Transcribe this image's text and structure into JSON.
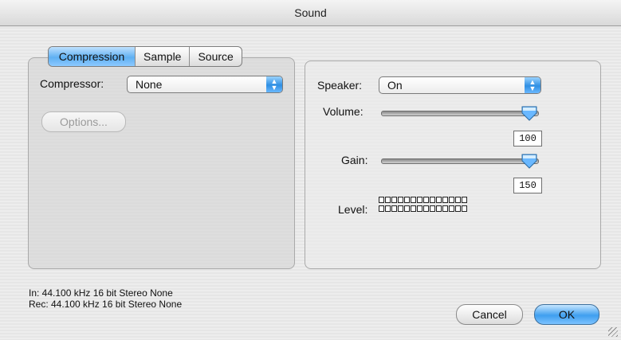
{
  "window": {
    "title": "Sound"
  },
  "tabs": [
    {
      "label": "Compression",
      "active": true
    },
    {
      "label": "Sample",
      "active": false
    },
    {
      "label": "Source",
      "active": false
    }
  ],
  "compression": {
    "compressor_label": "Compressor:",
    "compressor_value": "None",
    "options_label": "Options..."
  },
  "source": {
    "speaker_label": "Speaker:",
    "speaker_value": "On",
    "volume_label": "Volume:",
    "volume_value": "100",
    "gain_label": "Gain:",
    "gain_value": "150",
    "level_label": "Level:"
  },
  "status": {
    "in_line": "In: 44.100 kHz 16 bit Stereo None",
    "rec_line": "Rec: 44.100 kHz 16 bit Stereo None"
  },
  "buttons": {
    "cancel_label": "Cancel",
    "ok_label": "OK"
  },
  "colors": {
    "accent_blue": "#3f9fef",
    "panel_gray": "#d2d2d2"
  }
}
